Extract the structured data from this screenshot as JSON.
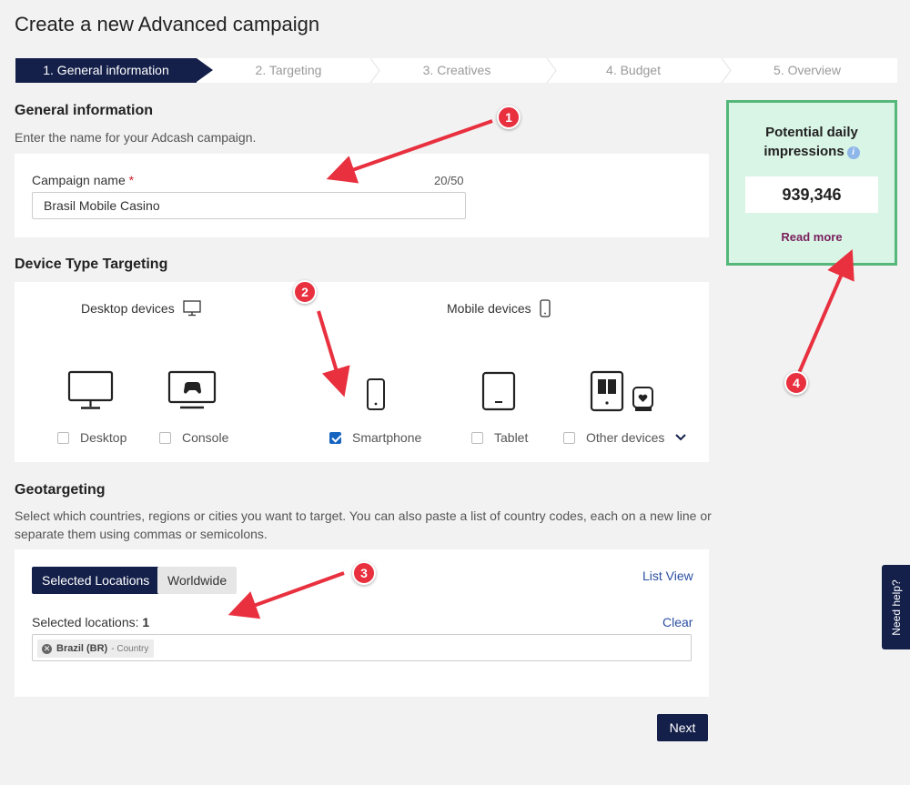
{
  "page": {
    "title": "Create a new Advanced campaign"
  },
  "stepper": {
    "steps": [
      {
        "label": "1. General information",
        "active": true
      },
      {
        "label": "2. Targeting",
        "active": false
      },
      {
        "label": "3. Creatives",
        "active": false
      },
      {
        "label": "4. Budget",
        "active": false
      },
      {
        "label": "5. Overview",
        "active": false
      }
    ]
  },
  "general": {
    "title": "General information",
    "description": "Enter the name for your Adcash campaign.",
    "campaign_name_label": "Campaign name",
    "required_mark": "*",
    "counter": "20/50",
    "campaign_name_value": "Brasil Mobile Casino"
  },
  "device": {
    "title": "Device Type Targeting",
    "desktop_heading": "Desktop devices",
    "mobile_heading": "Mobile devices",
    "options": [
      {
        "label": "Desktop",
        "checked": false,
        "icon": "monitor-icon"
      },
      {
        "label": "Console",
        "checked": false,
        "icon": "console-icon"
      },
      {
        "label": "Smartphone",
        "checked": true,
        "icon": "smartphone-icon"
      },
      {
        "label": "Tablet",
        "checked": false,
        "icon": "tablet-icon"
      },
      {
        "label": "Other devices",
        "checked": false,
        "icon": "ereader-watch-icon"
      }
    ]
  },
  "geo": {
    "title": "Geotargeting",
    "description": "Select which countries, regions or cities you want to target. You can also paste a list of country codes, each on a new line or separate them using commas or semicolons.",
    "tab_selected": "Selected Locations",
    "tab_worldwide": "Worldwide",
    "list_view": "List View",
    "selected_label": "Selected locations:",
    "selected_count": "1",
    "clear": "Clear",
    "tag_name": "Brazil (BR)",
    "tag_type": "- Country"
  },
  "actions": {
    "next": "Next"
  },
  "impressions": {
    "title_line1": "Potential daily",
    "title_line2": "impressions",
    "info": "i",
    "value": "939,346",
    "read_more": "Read more"
  },
  "help": {
    "label": "Need help?"
  },
  "annotations": [
    "1",
    "2",
    "3",
    "4"
  ],
  "colors": {
    "primary": "#14204a",
    "annotation_red": "#e8303f",
    "impressions_bg": "#d9f5e6",
    "impressions_border": "#55b77a",
    "read_more": "#7a1f5c",
    "link": "#2b4fa2",
    "checkbox": "#1565c0"
  }
}
